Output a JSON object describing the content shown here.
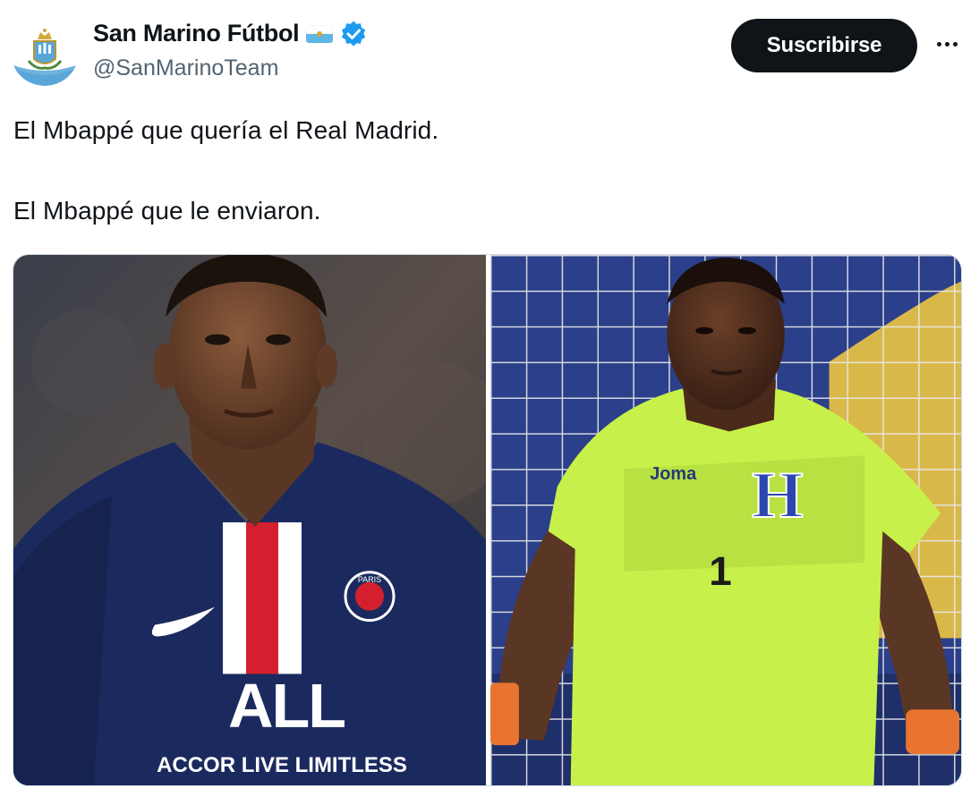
{
  "author": {
    "display_name": "San Marino Fútbol",
    "handle": "@SanMarinoTeam",
    "avatar_icon": "san-marino-crest-icon",
    "flag_icon": "san-marino-flag-icon",
    "verified_icon": "verified-badge-icon"
  },
  "actions": {
    "subscribe_label": "Suscribirse",
    "more_icon": "more-options-icon"
  },
  "tweet": {
    "line1": "El Mbappé que quería el Real Madrid.",
    "line2": "El Mbappé que le enviaron."
  },
  "media": {
    "left_photo": {
      "jersey_text": "ACCOR LIVE LIMITLESS",
      "sponsor_logo": "ALL",
      "crest_text": "PARIS"
    },
    "right_photo": {
      "jersey_brand": "Joma",
      "chest_letter": "H",
      "number": "1"
    }
  },
  "colors": {
    "accent_blue": "#1d9bf0",
    "text_primary": "#0f1419",
    "text_secondary": "#536471",
    "button_bg": "#0f1419",
    "psg_navy": "#1b2a5e",
    "psg_red": "#d4202e",
    "keeper_neon": "#c8f04a"
  }
}
